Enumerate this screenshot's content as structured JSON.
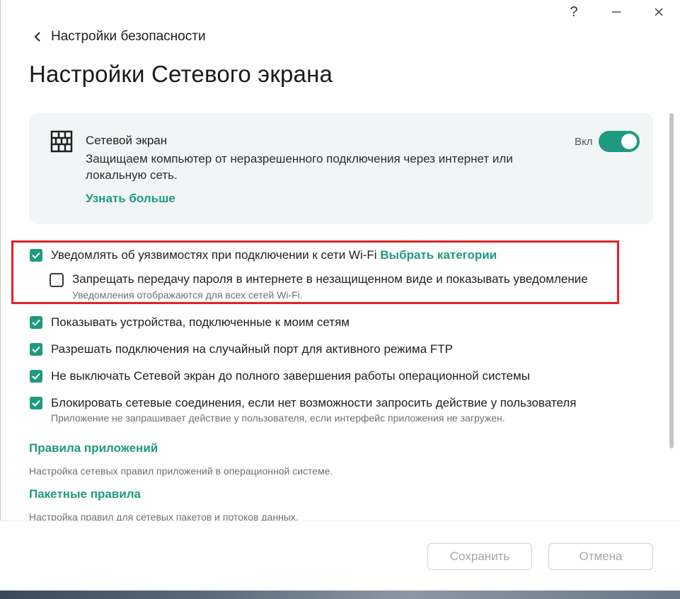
{
  "window": {
    "help_label": "?",
    "minimize_icon": "minimize-icon",
    "close_icon": "close-icon"
  },
  "nav": {
    "back_label": "Настройки безопасности"
  },
  "page": {
    "title": "Настройки Сетевого экрана"
  },
  "firewall_card": {
    "icon": "brick-wall-icon",
    "name": "Сетевой экран",
    "description": "Защищаем компьютер от неразрешенного подключения через интернет или локальную сеть.",
    "learn_more": "Узнать больше",
    "toggle_label": "Вкл",
    "enabled": true
  },
  "options": [
    {
      "label": "Уведомлять об уязвимостях при подключении к сети Wi-Fi",
      "link": "Выбрать категории",
      "checked": true
    },
    {
      "label": "Запрещать передачу пароля в интернете в незащищенном виде и показывать уведомление",
      "sub": "Уведомления отображаются для всех сетей Wi-Fi.",
      "checked": false
    },
    {
      "label": "Показывать устройства, подключенные к моим сетям",
      "checked": true
    },
    {
      "label": "Разрешать подключения на случайный порт для активного режима FTP",
      "checked": true
    },
    {
      "label": "Не выключать Сетевой экран до полного завершения работы операционной системы",
      "checked": true
    },
    {
      "label": "Блокировать сетевые соединения, если нет возможности запросить действие у пользователя",
      "sub": "Приложение не запрашивает действие у пользователя, если интерфейс приложения не загружен.",
      "checked": true
    }
  ],
  "sections": [
    {
      "title": "Правила приложений",
      "desc": "Настройка сетевых правил приложений в операционной системе."
    },
    {
      "title": "Пакетные правила",
      "desc": "Настройка правил для сетевых пакетов и потоков данных."
    }
  ],
  "footer": {
    "save_label": "Сохранить",
    "cancel_label": "Отмена"
  },
  "colors": {
    "accent": "#1f9a80",
    "highlight": "#e0222a",
    "card_bg": "#f2f5f6"
  }
}
